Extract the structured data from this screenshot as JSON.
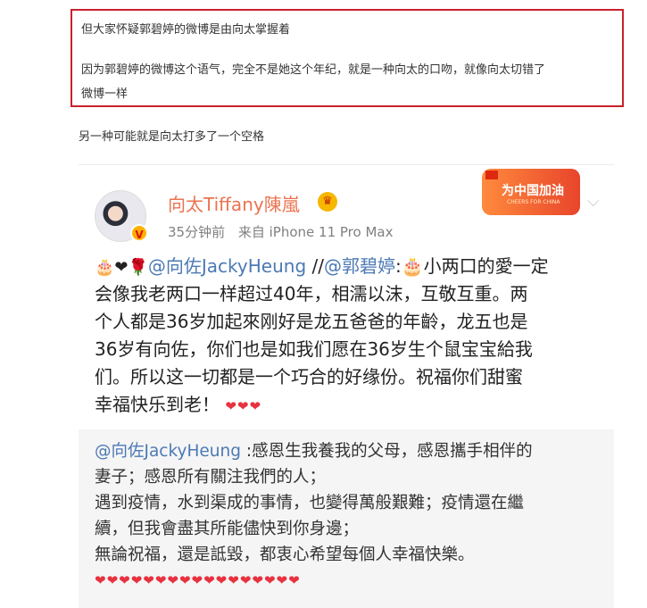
{
  "quote": {
    "line1": "但大家怀疑郭碧婷的微博是由向太掌握着",
    "line2": "因为郭碧婷的微博这个语气，完全不是她这个年纪，就是一种向太的口吻，就像向太切错了",
    "line3": "微博一样"
  },
  "extra": "另一种可能就是向太打多了一个空格",
  "post": {
    "username": "向太Tiffany陳嵐",
    "time": "35分钟前",
    "source": "来自 iPhone 11 Pro Max",
    "badge_text": "为中国加油",
    "badge_sub": "CHEERS FOR CHINA",
    "text": {
      "l1_emoji": "🎂❤🌹",
      "l1_mention1": "@向佐JackyHeung",
      "l1_sep": " //",
      "l1_mention2": "@郭碧婷",
      "l1_rest": ":🎂小两口的愛一定",
      "l2": "会像我老两口一样超过40年，相濡以沫，互敬互重。两",
      "l3": "个人都是36岁加起來刚好是龙五爸爸的年齡，龙五也是",
      "l4": "36岁有向佐，你们也是如我们愿在36岁生个鼠宝宝給我",
      "l5": "们。所以这一切都是一个巧合的好缘份。祝福你们甜蜜",
      "l6": "幸福快乐到老！",
      "l6_hearts": "❤❤❤"
    },
    "repost": {
      "mention": "@向佐JackyHeung",
      "l1_rest": " :感恩生我養我的父母，感恩攜手相伴的",
      "l2": "妻子；感恩所有關注我們的人；",
      "l3": "遇到疫情，水到渠成的事情，也變得萬般艱難；疫情還在繼",
      "l4": "續，但我會盡其所能儘快到你身邊；",
      "l5": "無論祝福，還是詆毀，都衷心希望每個人幸福快樂。",
      "hearts": "❤❤❤❤❤❤❤❤❤❤❤❤❤❤❤❤❤"
    }
  }
}
